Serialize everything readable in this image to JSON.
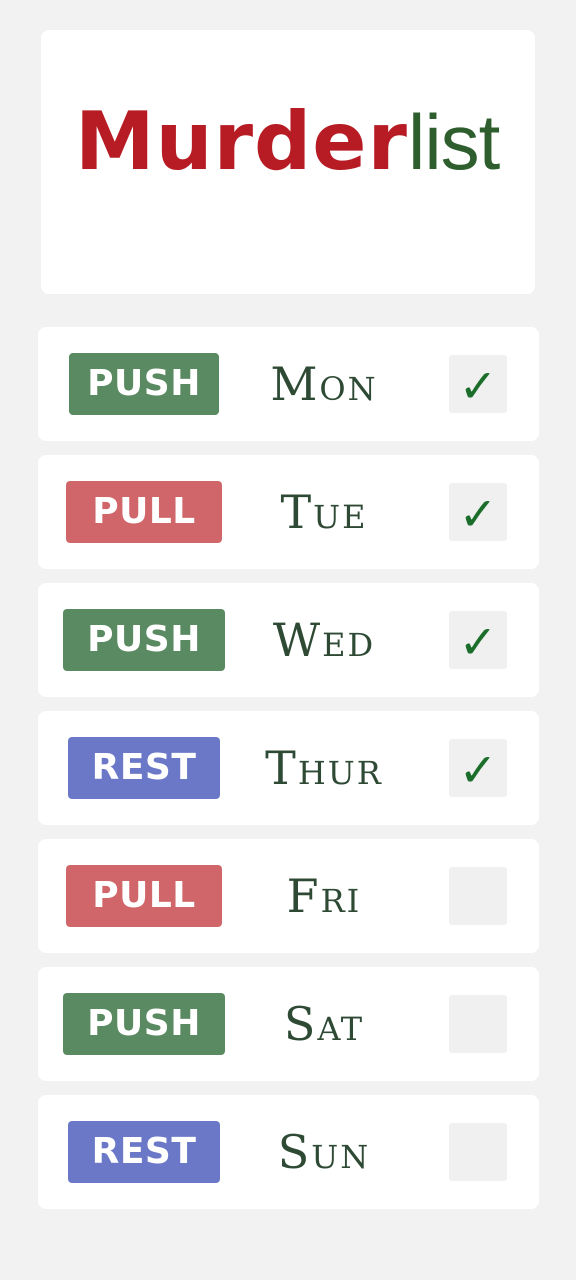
{
  "logo": {
    "primary": "Murder",
    "secondary": "list"
  },
  "colors": {
    "push": "#5a8a62",
    "pull": "#d1666a",
    "rest": "#6b78c8",
    "logo_red": "#b71c24",
    "logo_green": "#2e5e2e",
    "check": "#1b6e2a"
  },
  "check_icon": "check-mark-icon",
  "check_glyph": "✓",
  "days": [
    {
      "workout": "PUSH",
      "type": "push",
      "day": "Mon",
      "checked": true
    },
    {
      "workout": "PULL",
      "type": "pull",
      "day": "Tue",
      "checked": true
    },
    {
      "workout": "PUSH",
      "type": "push",
      "day": "Wed",
      "checked": true
    },
    {
      "workout": "REST",
      "type": "rest",
      "day": "Thur",
      "checked": true
    },
    {
      "workout": "PULL",
      "type": "pull",
      "day": "Fri",
      "checked": false
    },
    {
      "workout": "PUSH",
      "type": "push",
      "day": "Sat",
      "checked": false
    },
    {
      "workout": "REST",
      "type": "rest",
      "day": "Sun",
      "checked": false
    }
  ]
}
